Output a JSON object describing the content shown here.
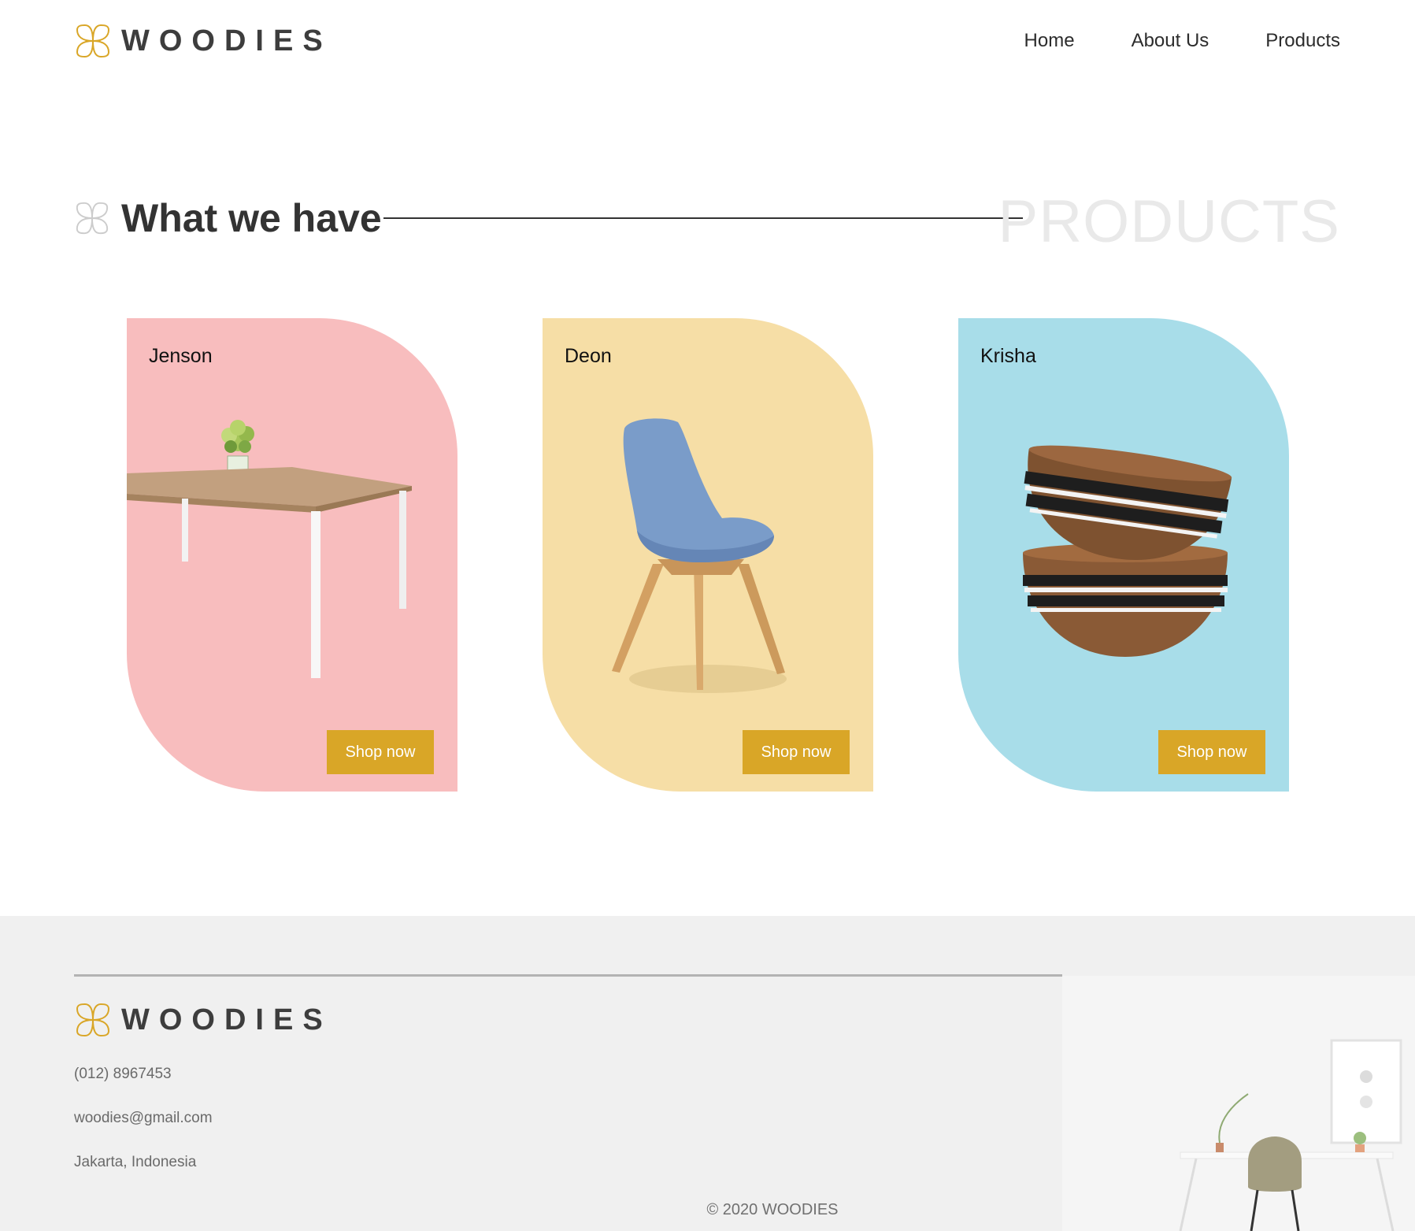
{
  "brand": {
    "name": "WOODIES"
  },
  "nav": {
    "home": "Home",
    "about": "About Us",
    "products": "Products"
  },
  "section": {
    "title": "What we have",
    "background_word": "PRODUCTS"
  },
  "products": [
    {
      "name": "Jenson",
      "button": "Shop now",
      "color": "#f8bdbe",
      "icon": "table-with-flowers"
    },
    {
      "name": "Deon",
      "button": "Shop now",
      "color": "#f6dea6",
      "icon": "blue-chair"
    },
    {
      "name": "Krisha",
      "button": "Shop now",
      "color": "#a8dde9",
      "icon": "wooden-bowls"
    }
  ],
  "footer": {
    "phone": "(012) 8967453",
    "email": "woodies@gmail.com",
    "address": "Jakarta, Indonesia",
    "copyright": "© 2020 WOODIES"
  },
  "colors": {
    "accent": "#d9a627",
    "text": "#333333",
    "footer_bg": "#f0f0f0"
  }
}
